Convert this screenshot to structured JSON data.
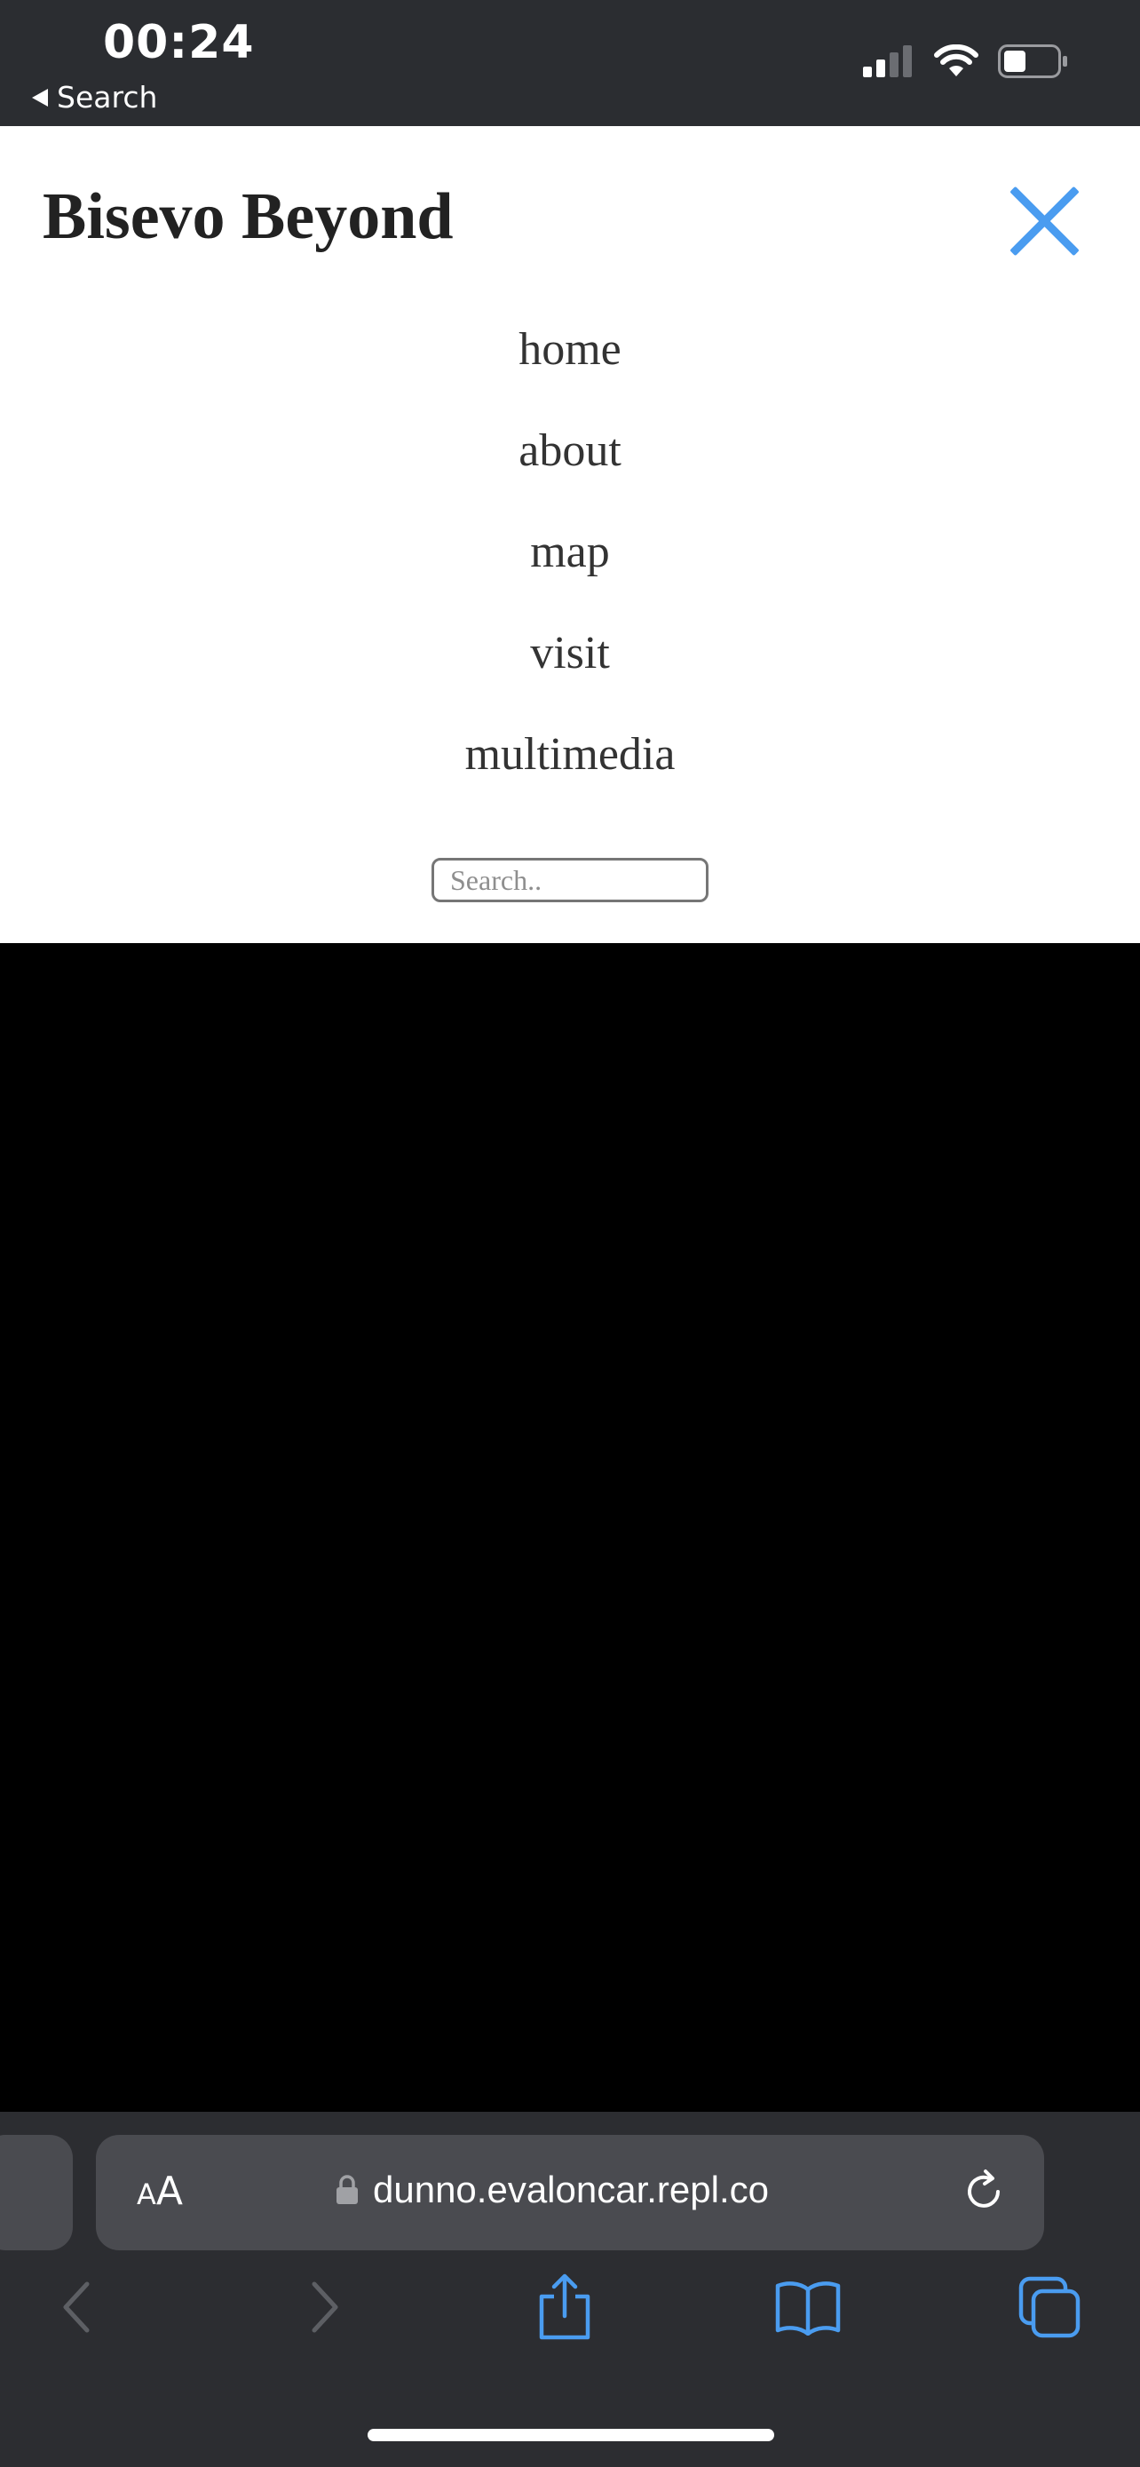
{
  "status_bar": {
    "time": "00:24",
    "back_label": "Search"
  },
  "site": {
    "title": "Bisevo Beyond"
  },
  "nav": {
    "items": [
      {
        "label": "home"
      },
      {
        "label": "about"
      },
      {
        "label": "map"
      },
      {
        "label": "visit"
      },
      {
        "label": "multimedia"
      }
    ]
  },
  "search": {
    "placeholder": "Search.."
  },
  "browser": {
    "text_size_label_small": "A",
    "text_size_label_big": "A",
    "url": "dunno.evaloncar.repl.co"
  },
  "colors": {
    "accent": "#4a9cf0",
    "status_bar_bg": "#2b2d31",
    "toolbar_bg": "#2c2d31"
  },
  "icons": {
    "close": "close-icon",
    "lock": "lock-icon",
    "reload": "reload-icon",
    "back": "chevron-left-icon",
    "forward": "chevron-right-icon",
    "share": "share-icon",
    "bookmarks": "book-icon",
    "tabs": "tabs-icon"
  }
}
